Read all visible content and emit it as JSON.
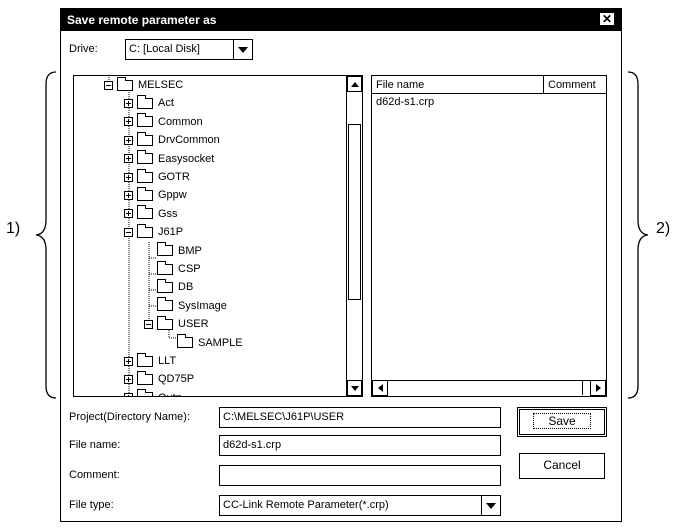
{
  "window": {
    "title": "Save remote parameter as"
  },
  "drive": {
    "label": "Drive:",
    "value": "C: [Local Disk]"
  },
  "tree": {
    "items": [
      {
        "label": "MELSEC",
        "expander": "minus"
      },
      {
        "label": "Act",
        "expander": "plus"
      },
      {
        "label": "Common",
        "expander": "plus"
      },
      {
        "label": "DrvCommon",
        "expander": "plus"
      },
      {
        "label": "Easysocket",
        "expander": "plus"
      },
      {
        "label": "GOTR",
        "expander": "plus"
      },
      {
        "label": "Gppw",
        "expander": "plus"
      },
      {
        "label": "Gss",
        "expander": "plus"
      },
      {
        "label": "J61P",
        "expander": "minus"
      },
      {
        "label": "BMP",
        "expander": ""
      },
      {
        "label": "CSP",
        "expander": ""
      },
      {
        "label": "DB",
        "expander": ""
      },
      {
        "label": "SysImage",
        "expander": ""
      },
      {
        "label": "USER",
        "expander": "minus"
      },
      {
        "label": "SAMPLE",
        "expander": ""
      },
      {
        "label": "LLT",
        "expander": "plus"
      },
      {
        "label": "QD75P",
        "expander": "plus"
      },
      {
        "label": "Qutn",
        "expander": "plus"
      }
    ]
  },
  "file_list": {
    "columns": [
      "File name",
      "Comment"
    ],
    "rows": [
      {
        "name": "d62d-s1.crp",
        "comment": ""
      }
    ]
  },
  "form": {
    "project_label": "Project(Directory Name):",
    "project_value": "C:\\MELSEC\\J61P\\USER",
    "filename_label": "File name:",
    "filename_value": "d62d-s1.crp",
    "comment_label": "Comment:",
    "comment_value": "",
    "filetype_label": "File type:",
    "filetype_value": "CC-Link Remote Parameter(*.crp)"
  },
  "buttons": {
    "save": "Save",
    "cancel": "Cancel"
  },
  "callouts": {
    "left": "1)",
    "right": "2)"
  }
}
